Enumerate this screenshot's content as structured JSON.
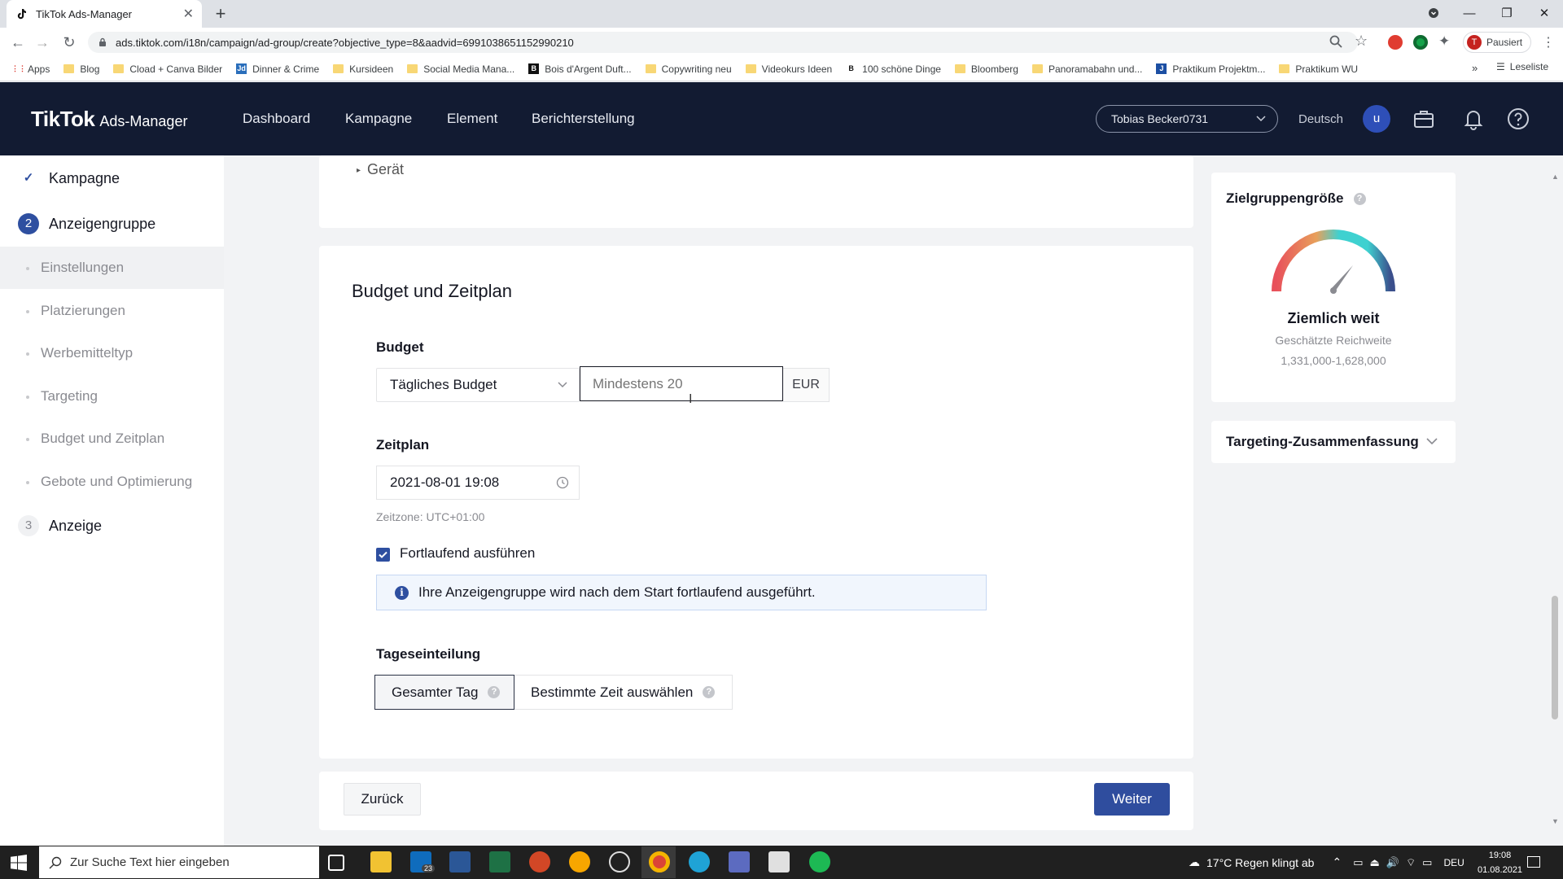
{
  "browser": {
    "tab_title": "TikTok Ads-Manager",
    "url": "ads.tiktok.com/i18n/campaign/ad-group/create?objective_type=8&aadvid=6991038651152990210",
    "profile_status": "Pausiert",
    "profile_initial": "T",
    "bookmarks": [
      "Apps",
      "Blog",
      "Cload + Canva Bilder",
      "Dinner & Crime",
      "Kursideen",
      "Social Media Mana...",
      "Bois d'Argent Duft...",
      "Copywriting neu",
      "Videokurs Ideen",
      "100 schöne Dinge",
      "Bloomberg",
      "Panoramabahn und...",
      "Praktikum Projektm...",
      "Praktikum WU"
    ],
    "reading_list": "Leseliste"
  },
  "header": {
    "logo_main": "TikTok",
    "logo_sub": "Ads-Manager",
    "nav": [
      "Dashboard",
      "Kampagne",
      "Element",
      "Berichterstellung"
    ],
    "account": "Tobias Becker0731",
    "language": "Deutsch",
    "avatar": "u"
  },
  "sidebar": {
    "steps": [
      {
        "label": "Kampagne",
        "marker": "✓"
      },
      {
        "label": "Anzeigengruppe",
        "marker": "2"
      },
      {
        "label": "Anzeige",
        "marker": "3"
      }
    ],
    "subitems": [
      "Einstellungen",
      "Platzierungen",
      "Werbemitteltyp",
      "Targeting",
      "Budget und Zeitplan",
      "Gebote und Optimierung"
    ]
  },
  "main": {
    "prev_section_item": "Gerät",
    "section_title": "Budget und Zeitplan",
    "budget_label": "Budget",
    "budget_type": "Tägliches Budget",
    "budget_placeholder": "Mindestens 20",
    "currency": "EUR",
    "schedule_label": "Zeitplan",
    "schedule_start": "2021-08-01 19:08",
    "timezone": "Zeitzone: UTC+01:00",
    "continuous_label": "Fortlaufend ausführen",
    "continuous_checked": true,
    "info_text": "Ihre Anzeigengruppe wird nach dem Start fortlaufend ausgeführt.",
    "dayparting_label": "Tageseinteilung",
    "dayparting_options": [
      "Gesamter Tag",
      "Bestimmte Zeit auswählen"
    ],
    "dayparting_selected": "Gesamter Tag",
    "back_button": "Zurück",
    "next_button": "Weiter"
  },
  "audience": {
    "title": "Zielgruppengröße",
    "level": "Ziemlich weit",
    "reach_label": "Geschätzte Reichweite",
    "reach_range": "1,331,000-1,628,000",
    "summary_title": "Targeting-Zusammenfassung"
  },
  "taskbar": {
    "search_placeholder": "Zur Suche Text hier eingeben",
    "mail_badge": "23",
    "weather": "17°C  Regen klingt ab",
    "keyboard_lang": "DEU",
    "time": "19:08",
    "date": "01.08.2021"
  },
  "colors": {
    "header_bg": "#121b32",
    "primary_button": "#2f4d9e",
    "gauge_left": "#e8515b",
    "gauge_mid": "#3fd1d0",
    "gauge_right": "#3b4f8c"
  }
}
